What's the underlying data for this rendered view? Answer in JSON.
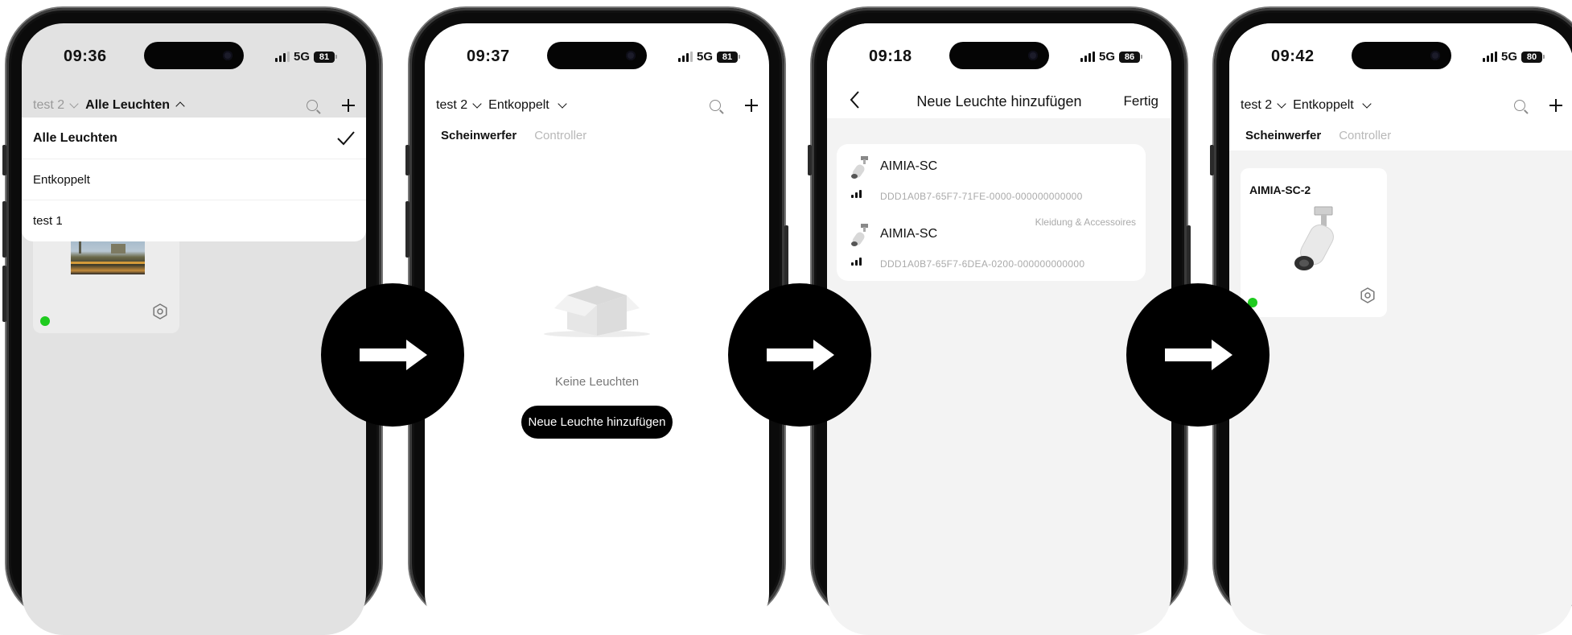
{
  "screens": [
    {
      "status": {
        "time": "09:36",
        "network": "5G",
        "battery": "81"
      },
      "header": {
        "group": "test 2",
        "filter": "Alle Leuchten"
      },
      "dropdown": {
        "items": [
          {
            "label": "Alle Leuchten",
            "selected": true
          },
          {
            "label": "Entkoppelt",
            "selected": false
          },
          {
            "label": "test 1",
            "selected": false
          }
        ]
      },
      "card": {
        "status_color": "#1ecb1e"
      }
    },
    {
      "status": {
        "time": "09:37",
        "network": "5G",
        "battery": "81"
      },
      "header": {
        "group": "test 2",
        "filter": "Entkoppelt"
      },
      "tabs": [
        "Scheinwerfer",
        "Controller"
      ],
      "empty": {
        "text": "Keine Leuchten",
        "button": "Neue Leuchte hinzufügen"
      }
    },
    {
      "status": {
        "time": "09:18",
        "network": "5G",
        "battery": "86"
      },
      "nav": {
        "title": "Neue Leuchte hinzufügen",
        "done": "Fertig"
      },
      "devices": [
        {
          "name": "AIMIA-SC",
          "id": "DDD1A0B7-65F7-71FE-0000-000000000000",
          "tag": ""
        },
        {
          "name": "AIMIA-SC",
          "id": "DDD1A0B7-65F7-6DEA-0200-000000000000",
          "tag": "Kleidung & Accessoires"
        }
      ]
    },
    {
      "status": {
        "time": "09:42",
        "network": "5G",
        "battery": "80"
      },
      "header": {
        "group": "test 2",
        "filter": "Entkoppelt"
      },
      "tabs": [
        "Scheinwerfer",
        "Controller"
      ],
      "card": {
        "name": "AIMIA-SC-2",
        "status_color": "#1ecb1e"
      }
    }
  ],
  "icons": [
    "search-icon",
    "plus-icon",
    "chevron-down-icon",
    "chevron-up-icon",
    "checkmark-icon",
    "back-icon",
    "gear-icon",
    "signal-icon",
    "battery-icon",
    "arrow-right-icon",
    "empty-box-icon",
    "spotlight-icon"
  ]
}
